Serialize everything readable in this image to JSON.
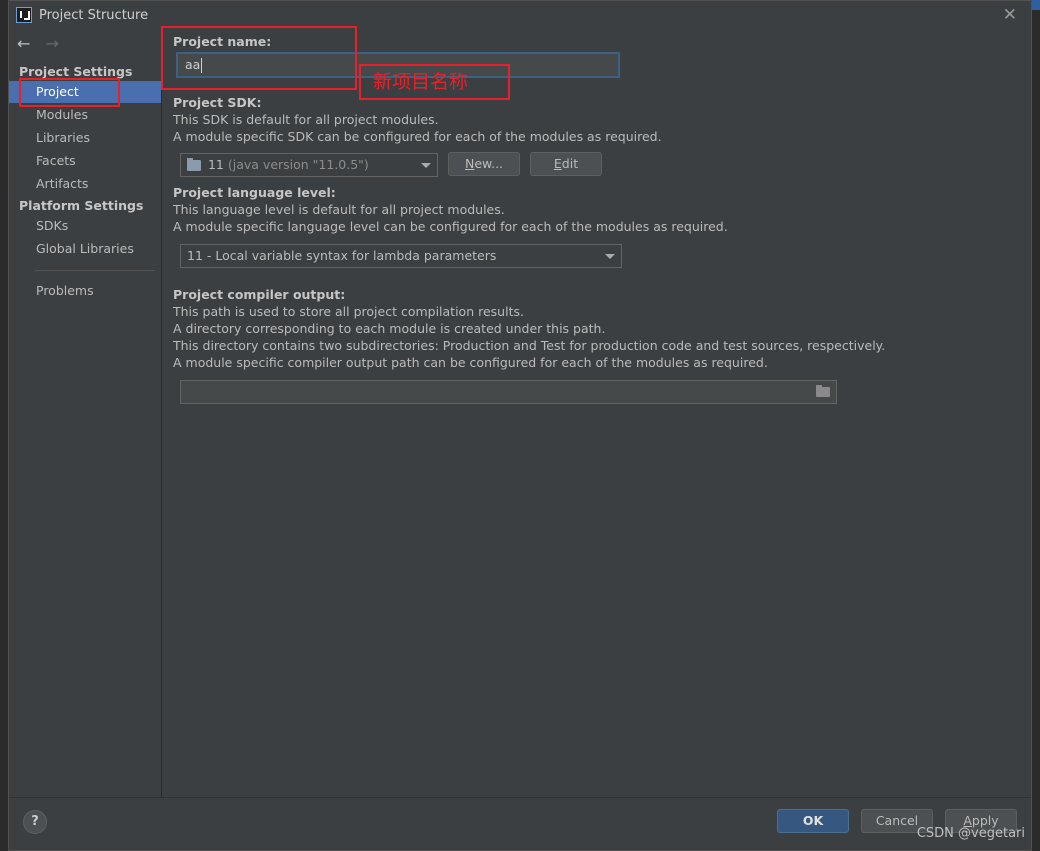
{
  "window": {
    "title": "Project Structure",
    "close_glyph": "✕"
  },
  "sidebar": {
    "back_glyph": "←",
    "forward_glyph": "→",
    "project_settings_header": "Project Settings",
    "project_settings_items": [
      "Project",
      "Modules",
      "Libraries",
      "Facets",
      "Artifacts"
    ],
    "platform_settings_header": "Platform Settings",
    "platform_settings_items": [
      "SDKs",
      "Global Libraries"
    ],
    "problems_label": "Problems",
    "selected_item": "Project"
  },
  "main": {
    "project_name_label": "Project name:",
    "project_name_value": "aa",
    "sdk_label": "Project SDK:",
    "sdk_desc_1": "This SDK is default for all project modules.",
    "sdk_desc_2": "A module specific SDK can be configured for each of the modules as required.",
    "sdk_selected": "11",
    "sdk_version": "(java version \"11.0.5\")",
    "new_button_mnemonic": "N",
    "new_button_rest": "ew...",
    "edit_button_mnemonic": "E",
    "edit_button_rest": "dit",
    "language_label": "Project language level:",
    "language_desc_1": "This language level is default for all project modules.",
    "language_desc_2": "A module specific language level can be configured for each of the modules as required.",
    "language_selected": "11 - Local variable syntax for lambda parameters",
    "output_label": "Project compiler output:",
    "output_desc_1": "This path is used to store all project compilation results.",
    "output_desc_2": "A directory corresponding to each module is created under this path.",
    "output_desc_3": "This directory contains two subdirectories: Production and Test for production code and test sources, respectively.",
    "output_desc_4": "A module specific compiler output path can be configured for each of the modules as required.",
    "output_value": ""
  },
  "annotation": {
    "text": "新项目名称",
    "color": "#e8202a"
  },
  "footer": {
    "help_glyph": "?",
    "ok_label": "OK",
    "cancel_label": "Cancel",
    "apply_mnemonic": "A",
    "apply_rest": "pply",
    "watermark": "CSDN @vegetari"
  },
  "colors": {
    "background": "#3c3f41",
    "selection": "#4b6eaf",
    "ok_button": "#365880",
    "focus_border": "#3d6185"
  },
  "icons": {
    "app": "intellij-idea-icon",
    "sdk": "jdk-folder-icon",
    "browse": "folder-icon",
    "help": "help-icon"
  }
}
